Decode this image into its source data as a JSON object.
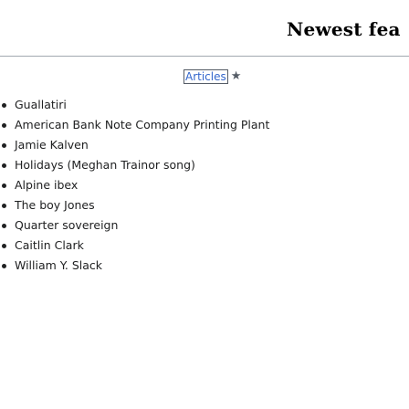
{
  "section": {
    "heading": "Newest fea"
  },
  "articles_tab": {
    "label": "Articles",
    "icon": "star-icon"
  },
  "articles": [
    "Guallatiri",
    "American Bank Note Company Printing Plant",
    "Jamie Kalven",
    "Holidays (Meghan Trainor song)",
    "Alpine ibex",
    "The boy Jones",
    "Quarter sovereign",
    "Caitlin Clark",
    "William Y. Slack"
  ]
}
